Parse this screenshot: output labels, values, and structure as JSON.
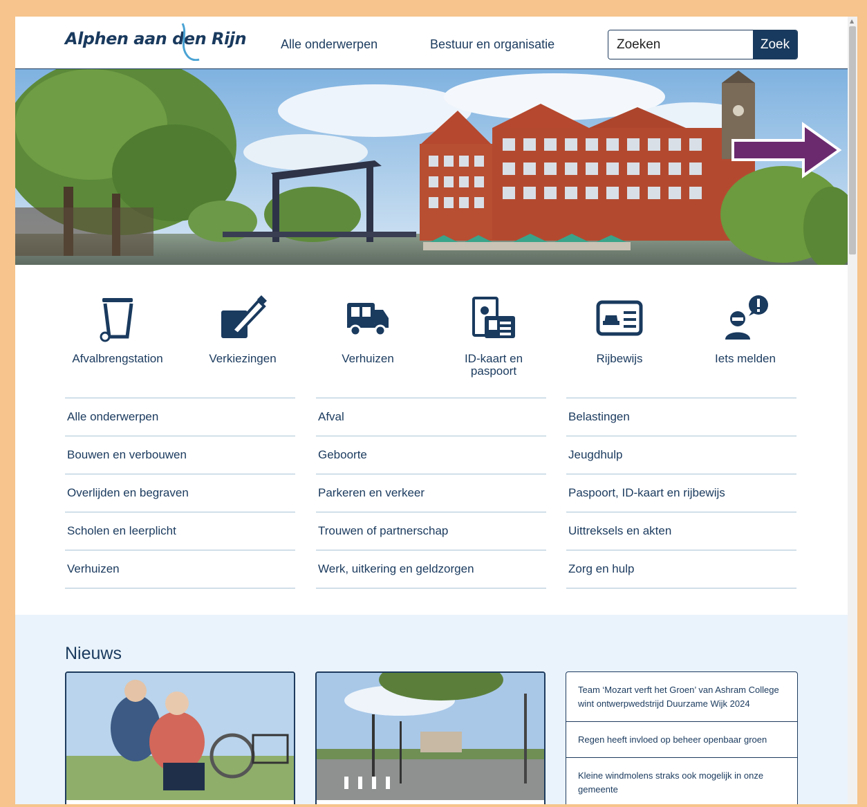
{
  "header": {
    "logo_text": "Alphen aan den Rijn",
    "nav": [
      "Alle onderwerpen",
      "Bestuur en organisatie"
    ],
    "search_placeholder": "Zoeken",
    "search_button": "Zoek"
  },
  "quick_links": [
    {
      "label": "Afvalbrengstation",
      "icon": "waste-bin-icon"
    },
    {
      "label": "Verkiezingen",
      "icon": "ballot-pencil-icon"
    },
    {
      "label": "Verhuizen",
      "icon": "moving-truck-icon"
    },
    {
      "label": "ID-kaart en paspoort",
      "icon": "id-card-passport-icon"
    },
    {
      "label": "Rijbewijs",
      "icon": "driving-license-icon"
    },
    {
      "label": "Iets melden",
      "icon": "report-person-icon"
    }
  ],
  "topics": [
    [
      "Alle onderwerpen",
      "Bouwen en verbouwen",
      "Overlijden en begraven",
      "Scholen en leerplicht",
      "Verhuizen"
    ],
    [
      "Afval",
      "Geboorte",
      "Parkeren en verkeer",
      "Trouwen of partnerschap",
      "Werk, uitkering en geldzorgen"
    ],
    [
      "Belastingen",
      "Jeugdhulp",
      "Paspoort, ID-kaart en rijbewijs",
      "Uittreksels en akten",
      "Zorg en hulp"
    ]
  ],
  "news": {
    "title": "Nieuws",
    "items": [
      "Team ‘Mozart verft het Groen’ van Ashram College wint ontwerpwedstrijd Duurzame Wijk 2024",
      "Regen heeft invloed op beheer openbaar groen",
      "Kleine windmolens straks ook mogelijk in onze gemeente"
    ]
  },
  "colors": {
    "brand": "#1a3a5e",
    "frame": "#f6c48c",
    "arrow": "#6b2a6e",
    "news_bg": "#eaf3fb"
  }
}
